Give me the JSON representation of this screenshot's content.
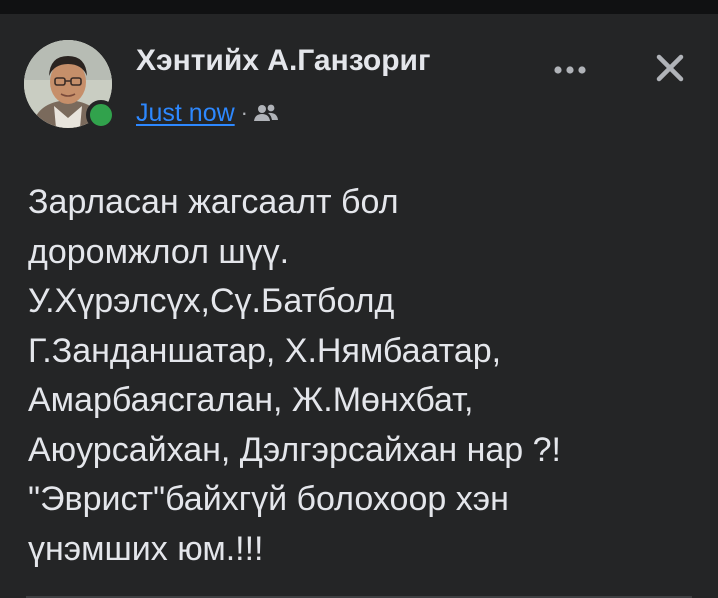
{
  "post": {
    "author": "Хэнтийх А.Ганзориг",
    "timestamp": "Just now",
    "separator": "·",
    "audience_icon": "friends-icon",
    "online_status": "online",
    "text_lines": [
      "Зарласан жагсаалт бол",
      "доромжлол шүү.",
      "У.Хүрэлсүх,Сү.Батболд",
      "Г.Занданшатар, Х.Нямбаатар,",
      "Амарбаясгалан, Ж.Мөнхбат,",
      "Аюурсайхан, Дэлгэрсайхан нар ?!",
      "\"Эврист\"байхгүй болохоор хэн",
      "үнэмших юм.!!!"
    ]
  },
  "actions": {
    "more_icon": "more-options-icon",
    "close_icon": "close-icon"
  },
  "colors": {
    "background": "#242526",
    "text": "#e4e6eb",
    "link": "#2d88ff",
    "online": "#31a24c",
    "secondary": "#b0b3b8"
  }
}
